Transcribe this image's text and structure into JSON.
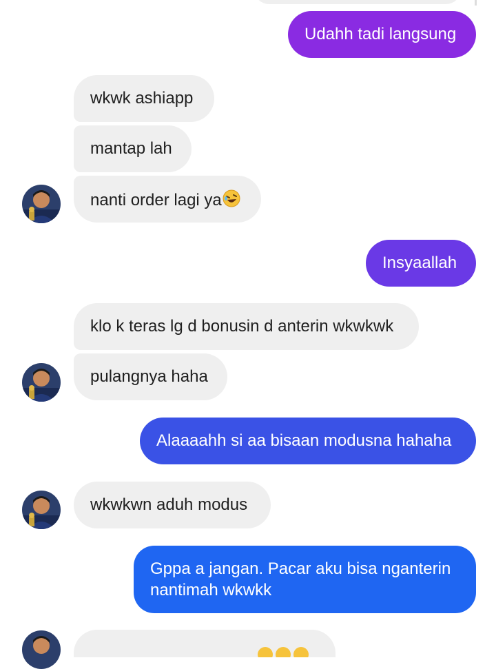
{
  "conversation": {
    "messages": [
      {
        "id": "m1",
        "direction": "outgoing",
        "text": "Udahh tadi langsung",
        "color": "#8a2be2"
      },
      {
        "id": "m2",
        "direction": "incoming",
        "text": "wkwk ashiapp"
      },
      {
        "id": "m3",
        "direction": "incoming",
        "text": "mantap lah"
      },
      {
        "id": "m4",
        "direction": "incoming",
        "text": "nanti order lagi ya",
        "emoji": "rolling-on-floor-laughing-emoji"
      },
      {
        "id": "m5",
        "direction": "outgoing",
        "text": "Insyaallah",
        "color": "#6a39e6"
      },
      {
        "id": "m6",
        "direction": "incoming",
        "text": "klo k teras lg d bonusin d anterin wkwkwk"
      },
      {
        "id": "m7",
        "direction": "incoming",
        "text": "pulangnya haha"
      },
      {
        "id": "m8",
        "direction": "outgoing",
        "text": "Alaaaahh si aa bisaan modusna hahaha",
        "color": "#3a52e6"
      },
      {
        "id": "m9",
        "direction": "incoming",
        "text": "wkwkwn aduh modus"
      },
      {
        "id": "m10",
        "direction": "outgoing",
        "text_line1": "Gppa a jangan. Pacar aku bisa nganterin",
        "text_line2": "nantimah wkwkk",
        "color": "#1f66f2"
      }
    ]
  },
  "colors": {
    "incoming_bubble": "#efefef",
    "outgoing_purple": "#8a2be2",
    "outgoing_violet": "#6a39e6",
    "outgoing_indigo": "#3a52e6",
    "outgoing_blue": "#1f66f2"
  }
}
